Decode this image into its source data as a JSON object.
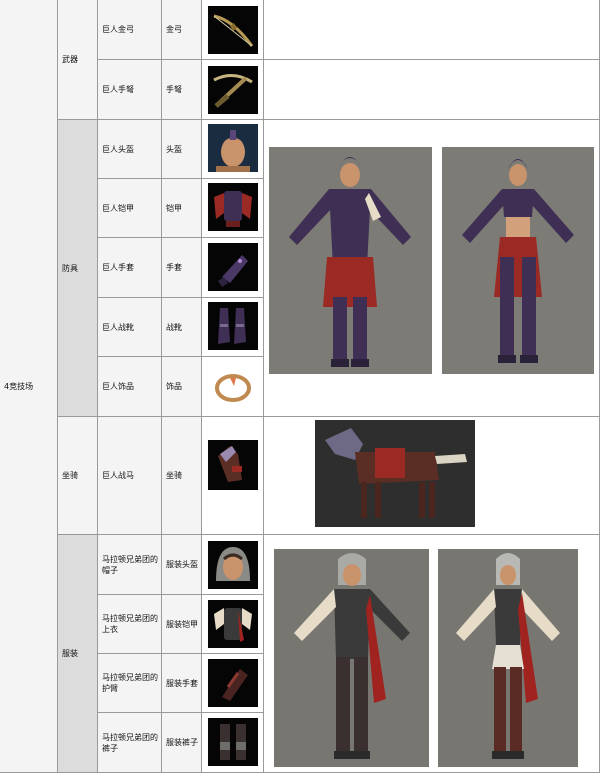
{
  "group": "4竞技场",
  "categories": {
    "weapon": "武器",
    "armor": "防具",
    "mount": "坐骑",
    "outfit": "服装"
  },
  "items": [
    {
      "name": "巨人金弓",
      "type": "金弓",
      "icon": "bow-icon"
    },
    {
      "name": "巨人手弩",
      "type": "手弩",
      "icon": "crossbow-icon"
    },
    {
      "name": "巨人头盔",
      "type": "头盔",
      "icon": "helmet-icon"
    },
    {
      "name": "巨人铠甲",
      "type": "铠甲",
      "icon": "armor-icon"
    },
    {
      "name": "巨人手套",
      "type": "手套",
      "icon": "gauntlet-icon"
    },
    {
      "name": "巨人战靴",
      "type": "战靴",
      "icon": "boots-icon"
    },
    {
      "name": "巨人饰品",
      "type": "饰品",
      "icon": "ring-icon"
    },
    {
      "name": "巨人战马",
      "type": "坐骑",
      "icon": "horse-icon"
    },
    {
      "name": "马拉顿兄弟团的帽子",
      "type": "服装头盔",
      "icon": "hood-icon"
    },
    {
      "name": "马拉顿兄弟团的上衣",
      "type": "服装铠甲",
      "icon": "tunic-icon"
    },
    {
      "name": "马拉顿兄弟团的护臂",
      "type": "服装手套",
      "icon": "bracer-icon"
    },
    {
      "name": "马拉顿兄弟团的裤子",
      "type": "服装裤子",
      "icon": "pants-icon"
    }
  ],
  "colors": {
    "armor_purple": "#3f2f55",
    "armor_red": "#9b2a25",
    "render_bg": "#7c7b75",
    "outfit_bg": "#777671",
    "horse_bg": "#2e2e2e"
  }
}
